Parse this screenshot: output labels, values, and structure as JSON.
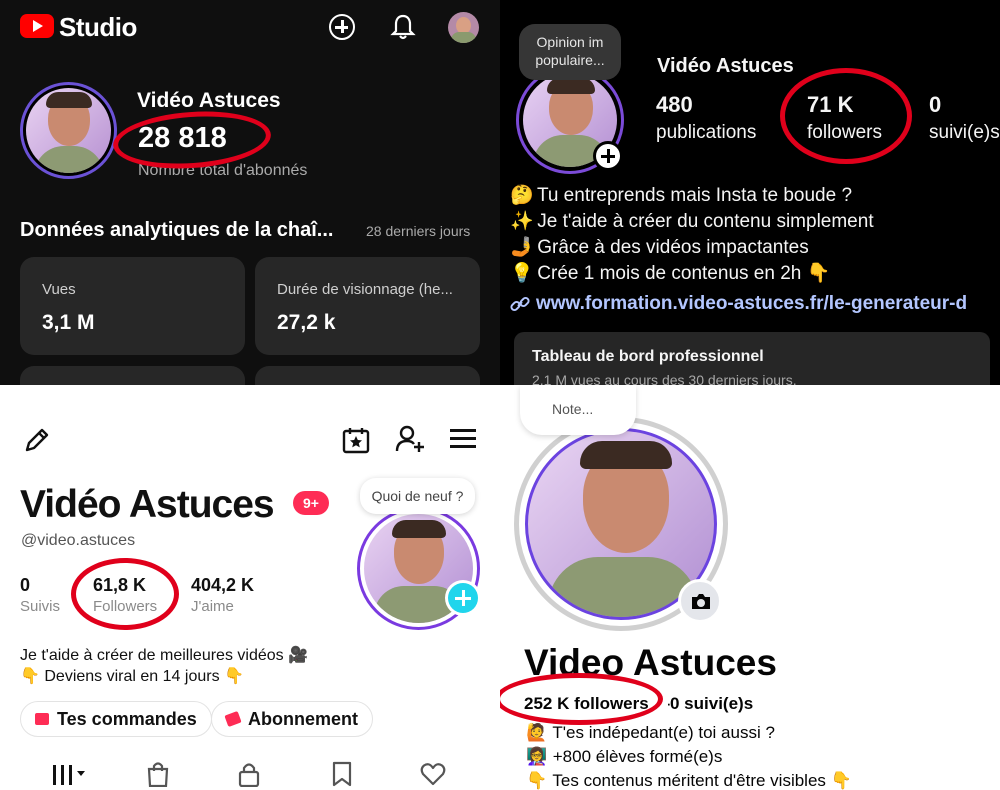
{
  "youtube": {
    "brand": "Studio",
    "channel_name": "Vidéo Astuces",
    "subscriber_count": "28 818",
    "subscriber_label": "Nombre total d'abonnés",
    "analytics_title": "Données analytiques de la chaî...",
    "analytics_period": "28 derniers jours",
    "cards": [
      {
        "label": "Vues",
        "value": "3,1 M"
      },
      {
        "label": "Durée de visionnage (he...",
        "value": "27,2 k"
      }
    ]
  },
  "instagram": {
    "note_bubble": "Opinion im populaire...",
    "name": "Vidéo Astuces",
    "stats": [
      {
        "value": "480",
        "label": "publications"
      },
      {
        "value": "71 K",
        "label": "followers"
      },
      {
        "value": "0",
        "label": "suivi(e)s"
      }
    ],
    "bio": [
      {
        "emoji": "🤔",
        "text": "Tu entreprends mais Insta te boude ?"
      },
      {
        "emoji": "✨",
        "text": "Je t'aide à créer du contenu simplement"
      },
      {
        "emoji": "🤳",
        "text": "Grâce à des vidéos impactantes"
      },
      {
        "emoji": "💡",
        "text": "Crée 1 mois de contenus en 2h 👇"
      }
    ],
    "link": "www.formation.video-astuces.fr/le-generateur-d",
    "dashboard_title": "Tableau de bord professionnel",
    "dashboard_subtitle": "2,1 M vues au cours des 30 derniers jours."
  },
  "tiktok": {
    "name": "Vidéo Astuces",
    "badge": "9+",
    "handle": "@video.astuces",
    "note_bubble": "Quoi de neuf ?",
    "stats": [
      {
        "value": "0",
        "label": "Suivis"
      },
      {
        "value": "61,8 K",
        "label": "Followers"
      },
      {
        "value": "404,2 K",
        "label": "J'aime"
      }
    ],
    "bio_line1": "Je t'aide à créer de meilleures vidéos 🎥",
    "bio_line2": "👇 Deviens viral en 14 jours 👇",
    "buttons": [
      "Tes commandes",
      "Abonnement"
    ]
  },
  "facebook": {
    "note_bubble": "Note...",
    "name": "Video Astuces",
    "followers": "252 K followers",
    "following": "0 suivi(e)s",
    "bio": [
      {
        "emoji": "🙋",
        "text": "T'es indépedant(e) toi aussi ?"
      },
      {
        "emoji": "👩‍🏫",
        "text": "+800 élèves formé(e)s"
      },
      {
        "emoji": "👇",
        "text": "Tes contenus méritent d'être visibles 👇"
      }
    ]
  },
  "colors": {
    "yt_red": "#ff0000",
    "highlight_red": "#e0001b",
    "ig_link": "#b3c6ff",
    "tiktok_badge": "#fe2c55",
    "tiktok_plus": "#20d5ec"
  }
}
